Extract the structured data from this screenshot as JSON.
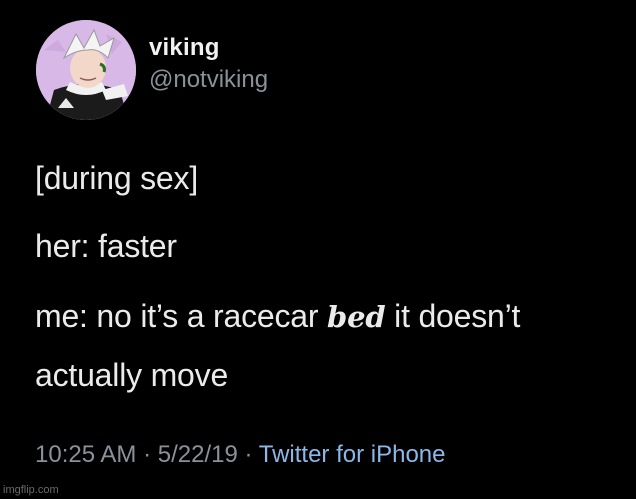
{
  "author": {
    "display_name": "viking",
    "handle": "@notviking",
    "avatar_icon": "cartoon-avatar"
  },
  "tweet": {
    "line1": "[during sex]",
    "line2": "her: faster",
    "line3_prefix": "me: no it’s a racecar",
    "line3_emphasis": "bed",
    "line3_suffix": "it doesn’t",
    "line4": "actually move"
  },
  "meta": {
    "time": "10:25 AM",
    "date": "5/22/19",
    "separator": "·",
    "source": "Twitter for iPhone"
  },
  "watermark": "imgflip.com",
  "colors": {
    "background": "#000000",
    "text": "#ebebeb",
    "muted": "#8a9299",
    "link": "#8bb8e8",
    "avatar_bg": "#d8b8e6"
  }
}
